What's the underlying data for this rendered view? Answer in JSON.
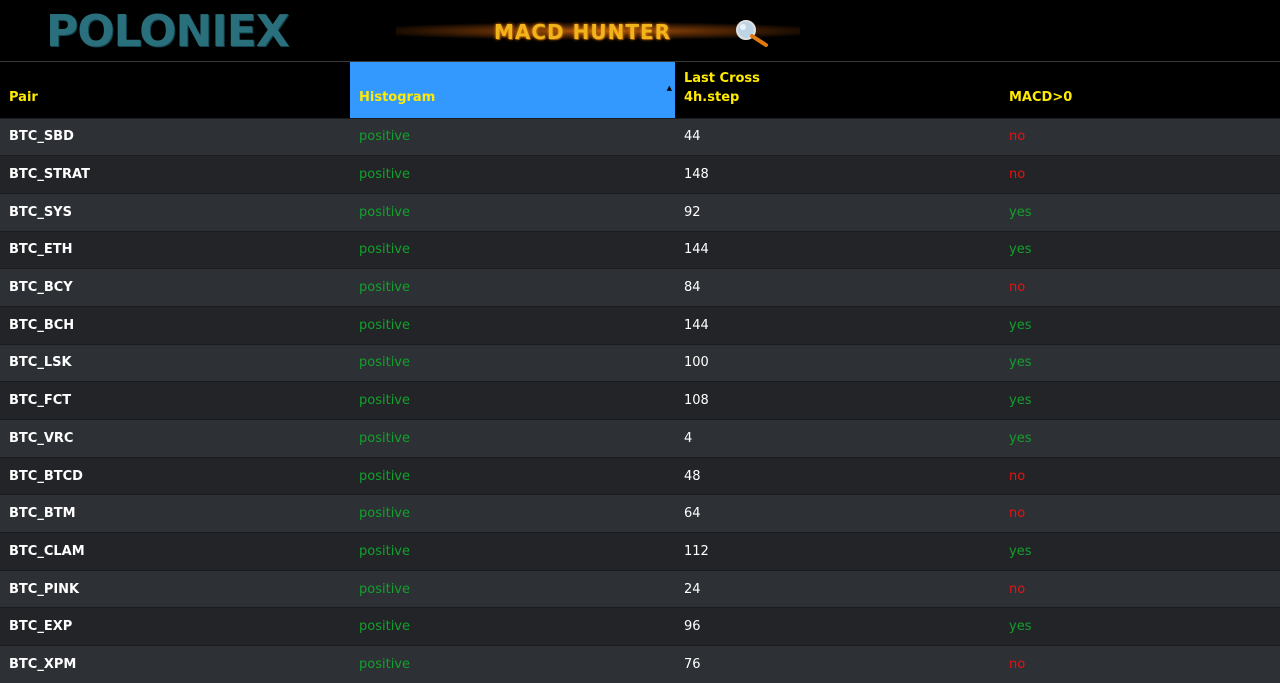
{
  "header": {
    "logo_text": "POLONIEX",
    "banner_title": "MACD HUNTER",
    "banner_icon": "magnifier-icon"
  },
  "table": {
    "columns": {
      "pair": "Pair",
      "histogram": "Histogram",
      "last_cross_line1": "Last Cross",
      "last_cross_line2": "4h.step",
      "macd": "MACD>0"
    },
    "sorted_column": "histogram",
    "colors": {
      "positive": "#13a02c",
      "negative": "#e41414",
      "header_text": "#ffea00",
      "sorted_header_bg": "#3399ff"
    },
    "rows": [
      {
        "pair": "BTC_SBD",
        "histogram": "positive",
        "last_cross": "44",
        "macd": "no"
      },
      {
        "pair": "BTC_STRAT",
        "histogram": "positive",
        "last_cross": "148",
        "macd": "no"
      },
      {
        "pair": "BTC_SYS",
        "histogram": "positive",
        "last_cross": "92",
        "macd": "yes"
      },
      {
        "pair": "BTC_ETH",
        "histogram": "positive",
        "last_cross": "144",
        "macd": "yes"
      },
      {
        "pair": "BTC_BCY",
        "histogram": "positive",
        "last_cross": "84",
        "macd": "no"
      },
      {
        "pair": "BTC_BCH",
        "histogram": "positive",
        "last_cross": "144",
        "macd": "yes"
      },
      {
        "pair": "BTC_LSK",
        "histogram": "positive",
        "last_cross": "100",
        "macd": "yes"
      },
      {
        "pair": "BTC_FCT",
        "histogram": "positive",
        "last_cross": "108",
        "macd": "yes"
      },
      {
        "pair": "BTC_VRC",
        "histogram": "positive",
        "last_cross": "4",
        "macd": "yes"
      },
      {
        "pair": "BTC_BTCD",
        "histogram": "positive",
        "last_cross": "48",
        "macd": "no"
      },
      {
        "pair": "BTC_BTM",
        "histogram": "positive",
        "last_cross": "64",
        "macd": "no"
      },
      {
        "pair": "BTC_CLAM",
        "histogram": "positive",
        "last_cross": "112",
        "macd": "yes"
      },
      {
        "pair": "BTC_PINK",
        "histogram": "positive",
        "last_cross": "24",
        "macd": "no"
      },
      {
        "pair": "BTC_EXP",
        "histogram": "positive",
        "last_cross": "96",
        "macd": "yes"
      },
      {
        "pair": "BTC_XPM",
        "histogram": "positive",
        "last_cross": "76",
        "macd": "no"
      }
    ]
  }
}
